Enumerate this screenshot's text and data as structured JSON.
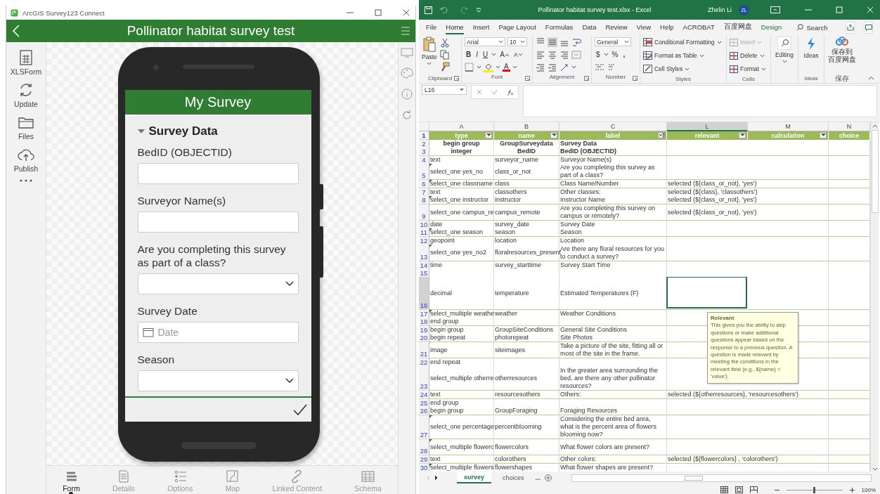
{
  "survey_app": {
    "window_title": "ArcGIS Survey123 Connect",
    "header_title": "Pollinator habitat survey test",
    "sidebar": [
      {
        "label": "XLSForm"
      },
      {
        "label": "Update"
      },
      {
        "label": "Files"
      },
      {
        "label": "Publish"
      }
    ],
    "form": {
      "title": "My Survey",
      "group": {
        "label": "Survey Data",
        "expanded": true
      },
      "questions": [
        {
          "kind": "text",
          "label": "BedID (OBJECTID)"
        },
        {
          "kind": "text",
          "label": "Surveyor Name(s)"
        },
        {
          "kind": "select",
          "label": "Are you completing this survey as part of a class?"
        },
        {
          "kind": "date",
          "label": "Survey Date",
          "placeholder": "Date"
        },
        {
          "kind": "select",
          "label": "Season"
        }
      ]
    },
    "bottom_tabs": [
      {
        "label": "Form",
        "selected": true
      },
      {
        "label": "Details",
        "selected": false
      },
      {
        "label": "Options",
        "selected": false
      },
      {
        "label": "Map",
        "selected": false
      },
      {
        "label": "Linked Content",
        "selected": false
      },
      {
        "label": "Schema",
        "selected": false
      }
    ]
  },
  "excel": {
    "title": "Pollinator habitat survey test.xlsx  -  Excel",
    "user": "Zhelin Li",
    "avatar": "ZL",
    "ribbon_tabs": [
      {
        "label": "File",
        "selected": false,
        "contextual": false
      },
      {
        "label": "Home",
        "selected": true,
        "contextual": false
      },
      {
        "label": "Insert",
        "selected": false,
        "contextual": false
      },
      {
        "label": "Page Layout",
        "selected": false,
        "contextual": false
      },
      {
        "label": "Formulas",
        "selected": false,
        "contextual": false
      },
      {
        "label": "Data",
        "selected": false,
        "contextual": false
      },
      {
        "label": "Review",
        "selected": false,
        "contextual": false
      },
      {
        "label": "View",
        "selected": false,
        "contextual": false
      },
      {
        "label": "Help",
        "selected": false,
        "contextual": false
      },
      {
        "label": "ACROBAT",
        "selected": false,
        "contextual": false
      },
      {
        "label": "百度网盘",
        "selected": false,
        "contextual": false
      },
      {
        "label": "Design",
        "selected": false,
        "contextual": true
      }
    ],
    "search": "Search",
    "clipboard": {
      "paste": "Paste",
      "label": "Clipboard"
    },
    "font": {
      "name": "Arial",
      "size": "10",
      "style_buttons": [
        "B",
        "I",
        "U"
      ],
      "grow": "A",
      "shrink": "A",
      "color_letter": "A",
      "label": "Font"
    },
    "alignment": {
      "label": "Alignment"
    },
    "number": {
      "format": "General",
      "currency": "$",
      "percent": "%",
      "comma": ",",
      "label": "Number"
    },
    "styles": {
      "buttons": [
        "Conditional Formatting",
        "Format as Table",
        "Cell Styles"
      ],
      "label": "Styles"
    },
    "cells": {
      "buttons": [
        {
          "label": "Insert",
          "disabled": true
        },
        {
          "label": "Delete",
          "disabled": false
        },
        {
          "label": "Format",
          "disabled": false
        }
      ],
      "label": "Cells"
    },
    "editing": "Editing",
    "ideas": {
      "button": "Ideas",
      "label": "Ideas"
    },
    "save": {
      "button_lines": [
        "保存到",
        "百度网盘"
      ],
      "label": "保存"
    },
    "name_box": "L16",
    "columns": [
      {
        "letter": "A",
        "heading": "type",
        "filtered": false,
        "selected": false
      },
      {
        "letter": "B",
        "heading": "name",
        "filtered": false,
        "selected": false
      },
      {
        "letter": "C",
        "heading": "label",
        "filtered": true,
        "selected": false
      },
      {
        "letter": "L",
        "heading": "relevant",
        "filtered": false,
        "selected": true
      },
      {
        "letter": "M",
        "heading": "calculation",
        "filtered": false,
        "selected": false
      },
      {
        "letter": "N",
        "heading": "choice",
        "selected": false
      }
    ],
    "header_row_number": "1",
    "rows": [
      {
        "number": "2",
        "type": "begin group",
        "name": "GroupSurveydata",
        "label": "Survey Data",
        "bold": true,
        "flagged": false,
        "selected": false
      },
      {
        "number": "3",
        "type": "integer",
        "name": "BedID",
        "label": "BedID (OBJECTID)",
        "bold": true,
        "flagged": false,
        "selected": false
      },
      {
        "number": "4",
        "type": "text",
        "name": "surveyor_name",
        "label": "Surveyor Name(s)",
        "bold": false,
        "flagged": false,
        "selected": false
      },
      {
        "number": "5",
        "type": "select_one yes_no",
        "name": "class_or_not",
        "label": "Are you completing this survey as part of a class?",
        "bold": false,
        "flagged": true,
        "selected": false
      },
      {
        "number": "6",
        "type": "select_one classname",
        "name": "class",
        "label": "Class Name/Number",
        "relevant": "selected (${class_or_not}, 'yes')",
        "bold": false,
        "flagged": true,
        "selected": false
      },
      {
        "number": "7",
        "type": "text",
        "name": "classothers",
        "label": "Other classes:",
        "relevant": "selected (${class}, 'classothers')",
        "bold": false,
        "flagged": false,
        "selected": false
      },
      {
        "number": "8",
        "type": "select_one instructor",
        "name": "instructor",
        "label": "Instructor Name",
        "relevant": "selected (${class_or_not}, 'yes')",
        "bold": false,
        "flagged": true,
        "selected": false
      },
      {
        "number": "9",
        "type": "select_one campus_re",
        "name": "campus_remote",
        "label": "Are you completing this survey on campus or remotely?",
        "relevant": "selected (${class_or_not}, 'yes')",
        "bold": false,
        "flagged": false,
        "selected": false
      },
      {
        "number": "10",
        "type": "date",
        "name": "survey_date",
        "label": "Survey Date",
        "bold": false,
        "flagged": false,
        "selected": false
      },
      {
        "number": "11",
        "type": "select_one season",
        "name": "season",
        "label": "Season",
        "bold": false,
        "flagged": true,
        "selected": false
      },
      {
        "number": "12",
        "type": "geopoint",
        "name": "location",
        "label": "Location",
        "bold": false,
        "flagged": false,
        "selected": false
      },
      {
        "number": "13",
        "type": "select_one yes_no2",
        "name": "floralresources_present",
        "label": "Are there any floral resources for you to conduct a survey?",
        "bold": false,
        "flagged": true,
        "selected": false
      },
      {
        "number": "14",
        "type": "time",
        "name": "survey_starttime",
        "label": "Survey Start Time",
        "bold": false,
        "flagged": false,
        "selected": false
      },
      {
        "number": "15",
        "bold": false,
        "flagged": false,
        "selected": false
      },
      {
        "number": "16",
        "type": "decimal",
        "name": "temperature",
        "label": "Estimated Temperatures (F)",
        "bold": false,
        "flagged": false,
        "selected": true
      },
      {
        "number": "17",
        "type": "select_multiple weathe",
        "name": "weather",
        "label": "Weather Conditions",
        "bold": false,
        "flagged": true,
        "selected": false
      },
      {
        "number": "18",
        "type": "end group",
        "bold": false,
        "flagged": false,
        "selected": false
      },
      {
        "number": "19",
        "type": "begin group",
        "name": "GroupSiteConditions",
        "label": "General Site Conditions",
        "bold": false,
        "flagged": false,
        "selected": false
      },
      {
        "number": "20",
        "type": "begin repeat",
        "name": "photorepeat",
        "label": "Site Photos",
        "bold": false,
        "flagged": false,
        "selected": false
      },
      {
        "number": "21",
        "type": "image",
        "name": "siteimages",
        "label": "Take a picture of the site, fitting all or most of the site in the frame.",
        "bold": false,
        "flagged": false,
        "selected": false
      },
      {
        "number": "22",
        "type": "end repeat",
        "bold": false,
        "flagged": false,
        "selected": false
      },
      {
        "number": "23",
        "type": "select_multiple otherre",
        "name": "otherresources",
        "label": "In the greater area surrounding the bed, are there any other pollinator resources?",
        "bold": false,
        "flagged": false,
        "selected": false
      },
      {
        "number": "24",
        "type": "text",
        "name": "resourcesothers",
        "label": "Others:",
        "relevant": "selected (${otherresources}, 'resourcesothers')",
        "bold": false,
        "flagged": false,
        "selected": false
      },
      {
        "number": "25",
        "type": "end group",
        "bold": false,
        "flagged": false,
        "selected": false
      },
      {
        "number": "26",
        "type": "begin group",
        "name": "GroupForaging",
        "label": "Foraging Resources",
        "bold": false,
        "flagged": false,
        "selected": false
      },
      {
        "number": "27",
        "type": "select_one percentage",
        "name": "percentblooming",
        "label": "Considering the entire bed area, what is the percent area of flowers blooming now?",
        "bold": false,
        "flagged": true,
        "selected": false
      },
      {
        "number": "28",
        "type": "select_multiple flowerc",
        "name": "flowercolors",
        "label": "What flower colors are present?",
        "bold": false,
        "flagged": true,
        "selected": false
      },
      {
        "number": "29",
        "type": "text",
        "name": "colorothers",
        "label": "Other colors:",
        "relevant": "selected (${flowercolors} , 'colorothers')",
        "bold": false,
        "flagged": false,
        "selected": false
      },
      {
        "number": "30",
        "type": "select_multiple flowers",
        "name": "flowershapes",
        "label": "What flower shapes are present?",
        "bold": false,
        "flagged": true,
        "selected": false
      }
    ],
    "tooltip": {
      "title": "Relevant",
      "text": "This gives you the ability to skip questions or make additional questions appear based on the response to a previous question. A question is made relevant by meeting the conditions in the relevant field (e.g., ${name} = 'value')."
    },
    "sheet_tabs": [
      {
        "label": "survey",
        "selected": true
      },
      {
        "label": "choices",
        "selected": false
      }
    ],
    "more_sheets": "...",
    "zoom_slider": {
      "level": 0.5
    },
    "zoom": "100%"
  }
}
